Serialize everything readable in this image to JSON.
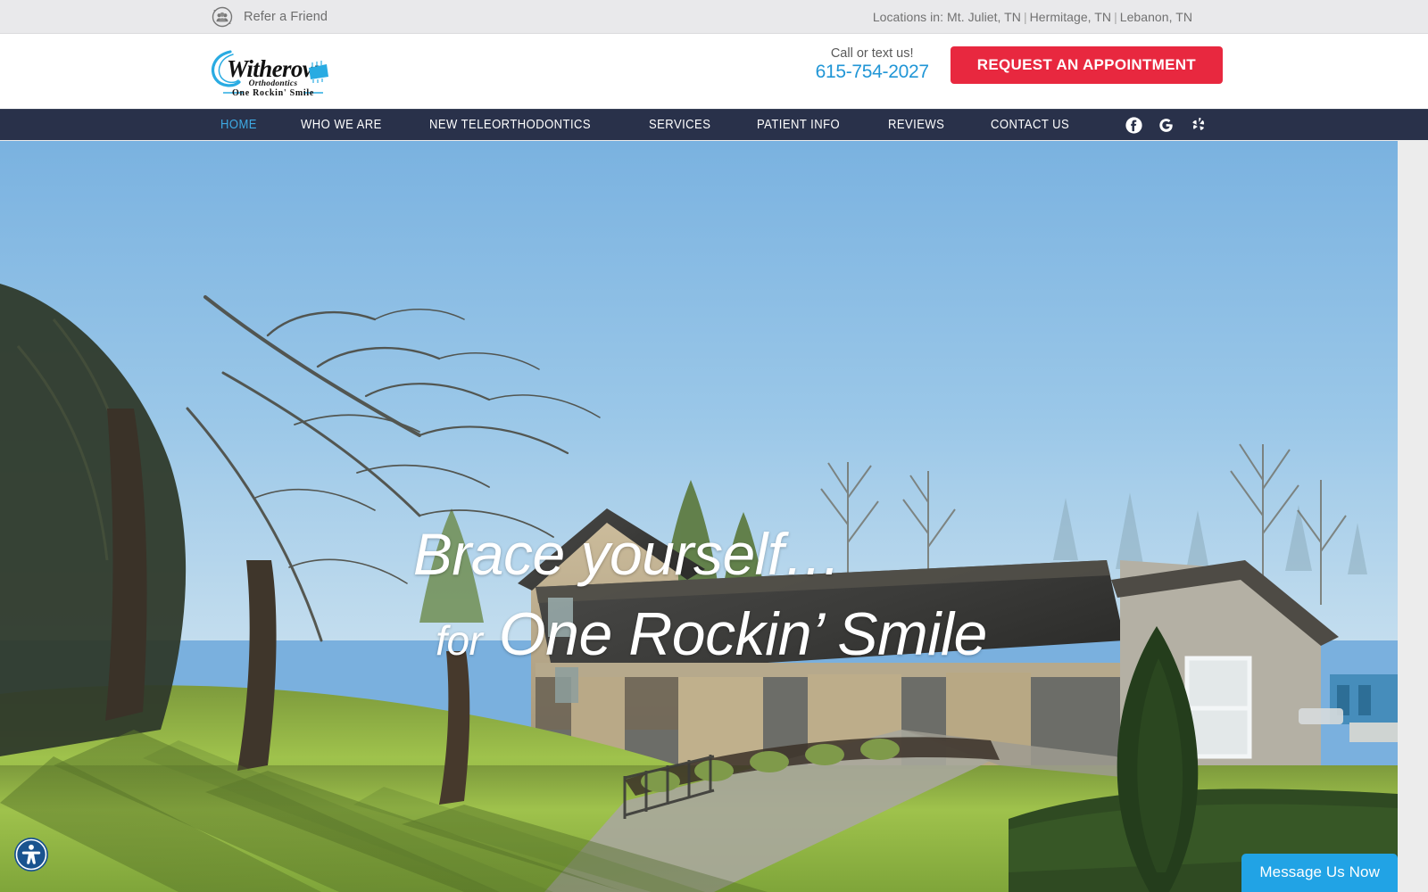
{
  "topbar": {
    "refer_icon": "refer-a-friend-icon",
    "refer_label": "Refer a Friend",
    "locations_prefix": "Locations in:",
    "locations": [
      "Mt. Juliet, TN",
      "Hermitage, TN",
      "Lebanon, TN"
    ],
    "separator": "|",
    "bg_color": "#e9e9eb"
  },
  "header": {
    "logo": {
      "name": "Witherow",
      "subtitle": "Orthodontics",
      "tagline": "One Rockin' Smile",
      "brand_color": "#29abe2"
    },
    "phone_label": "Call or text us!",
    "phone_number": "615-754-2027",
    "phone_color": "#2196d6",
    "cta_label": "REQUEST AN APPOINTMENT",
    "cta_color": "#e8283f"
  },
  "nav": {
    "bg_color": "#29314a",
    "active_color": "#3ea9e3",
    "items": [
      {
        "label": "HOME",
        "active": true
      },
      {
        "label": "WHO WE ARE",
        "active": false
      },
      {
        "label": "NEW TELEORTHODONTICS",
        "active": false
      },
      {
        "label": "SERVICES",
        "active": false
      },
      {
        "label": "PATIENT INFO",
        "active": false
      },
      {
        "label": "REVIEWS",
        "active": false
      },
      {
        "label": "CONTACT US",
        "active": false
      }
    ],
    "socials": [
      {
        "name": "facebook-icon",
        "label": "Facebook"
      },
      {
        "name": "google-icon",
        "label": "Google"
      },
      {
        "name": "yelp-icon",
        "label": "Yelp"
      }
    ]
  },
  "hero": {
    "headline_line1": "Brace yourself…",
    "headline_line2_small": "for",
    "headline_line2": "One Rockin’ Smile",
    "description": "Exterior photo of the orthodontic office building with a sunlit green lawn, bare winter trees and a clear blue sky",
    "text_color": "#ffffff"
  },
  "widgets": {
    "accessibility_icon": "accessibility-icon",
    "accessibility_color": "#19538f",
    "chat_label": "Message Us Now",
    "chat_color": "#21a3e5"
  }
}
